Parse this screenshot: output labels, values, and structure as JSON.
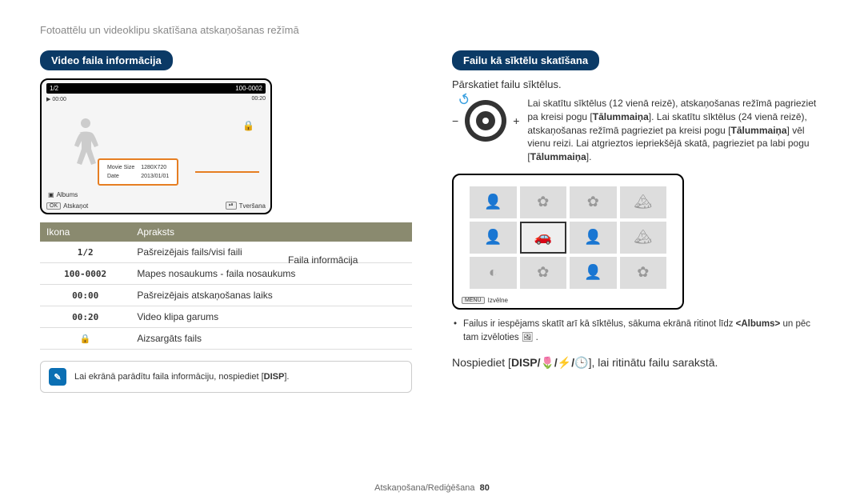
{
  "breadcrumb": "Fotoattēlu un videoklipu skatīšana atskaņošanas režīmā",
  "left": {
    "section_title": "Video faila informācija",
    "preview": {
      "counter": "1/2",
      "folder_file": "100-0002",
      "play_icon": "▶",
      "time_current": "00:00",
      "time_total": "00:20",
      "lock_icon": "🔒",
      "infobox_rows": [
        {
          "k": "Movie Size",
          "v": "1280X720"
        },
        {
          "k": "Date",
          "v": "2013/01/01"
        }
      ],
      "albums_label": "Albums",
      "ok_btn": "OK",
      "ok_label": "Atskaņot",
      "capture_btn": "⏯",
      "capture_label": "Tveršana"
    },
    "info_callout": "Faila informācija",
    "table": {
      "head_icon": "Ikona",
      "head_desc": "Apraksts",
      "rows": [
        {
          "icon": "1/2",
          "desc": "Pašreizējais fails/visi faili"
        },
        {
          "icon": "100-0002",
          "desc": "Mapes nosaukums - faila nosaukums"
        },
        {
          "icon": "00:00",
          "desc": "Pašreizējais atskaņošanas laiks"
        },
        {
          "icon": "00:20",
          "desc": "Video klipa garums"
        },
        {
          "icon": "🔒",
          "desc": "Aizsargāts fails"
        }
      ]
    },
    "tip": {
      "text_a": "Lai ekrānā parādītu faila informāciju, nospiediet [",
      "key": "DISP",
      "text_b": "]."
    }
  },
  "right": {
    "section_title": "Failu kā sīktēlu skatīšana",
    "intro": "Pārskatiet failu sīktēlus.",
    "dial": {
      "text_a": "Lai skatītu sīktēlus (12 vienā reizē), atskaņošanas režīmā pagrieziet pa kreisi pogu [",
      "b1": "Tālummaiņa",
      "text_b": "]. Lai skatītu sīktēlus (24 vienā reizē), atskaņošanas režīmā pagrieziet pa kreisi pogu [",
      "b2": "Tālummaiņa",
      "text_c": "] vēl vienu reizi. Lai atgrieztos iepriekšējā skatā, pagrieziet pa labi pogu [",
      "b3": "Tālummaiņa",
      "text_d": "]."
    },
    "thumb_menu_btn": "MENU",
    "thumb_menu_label": "Izvēlne",
    "note": {
      "a": "Failus ir iespējams skatīt arī kā sīktēlus, sākuma ekrānā ritinot līdz ",
      "b": "<Albums>",
      "c": " un pēc tam izvēloties ",
      "icon": "🖼"
    },
    "press": {
      "a": "Nospiediet [",
      "keys": "DISP/🌷/⚡/🕒",
      "b": "], lai ritinātu failu sarakstā."
    }
  },
  "footer": {
    "section": "Atskaņošana/Rediģēšana",
    "page": "80"
  }
}
